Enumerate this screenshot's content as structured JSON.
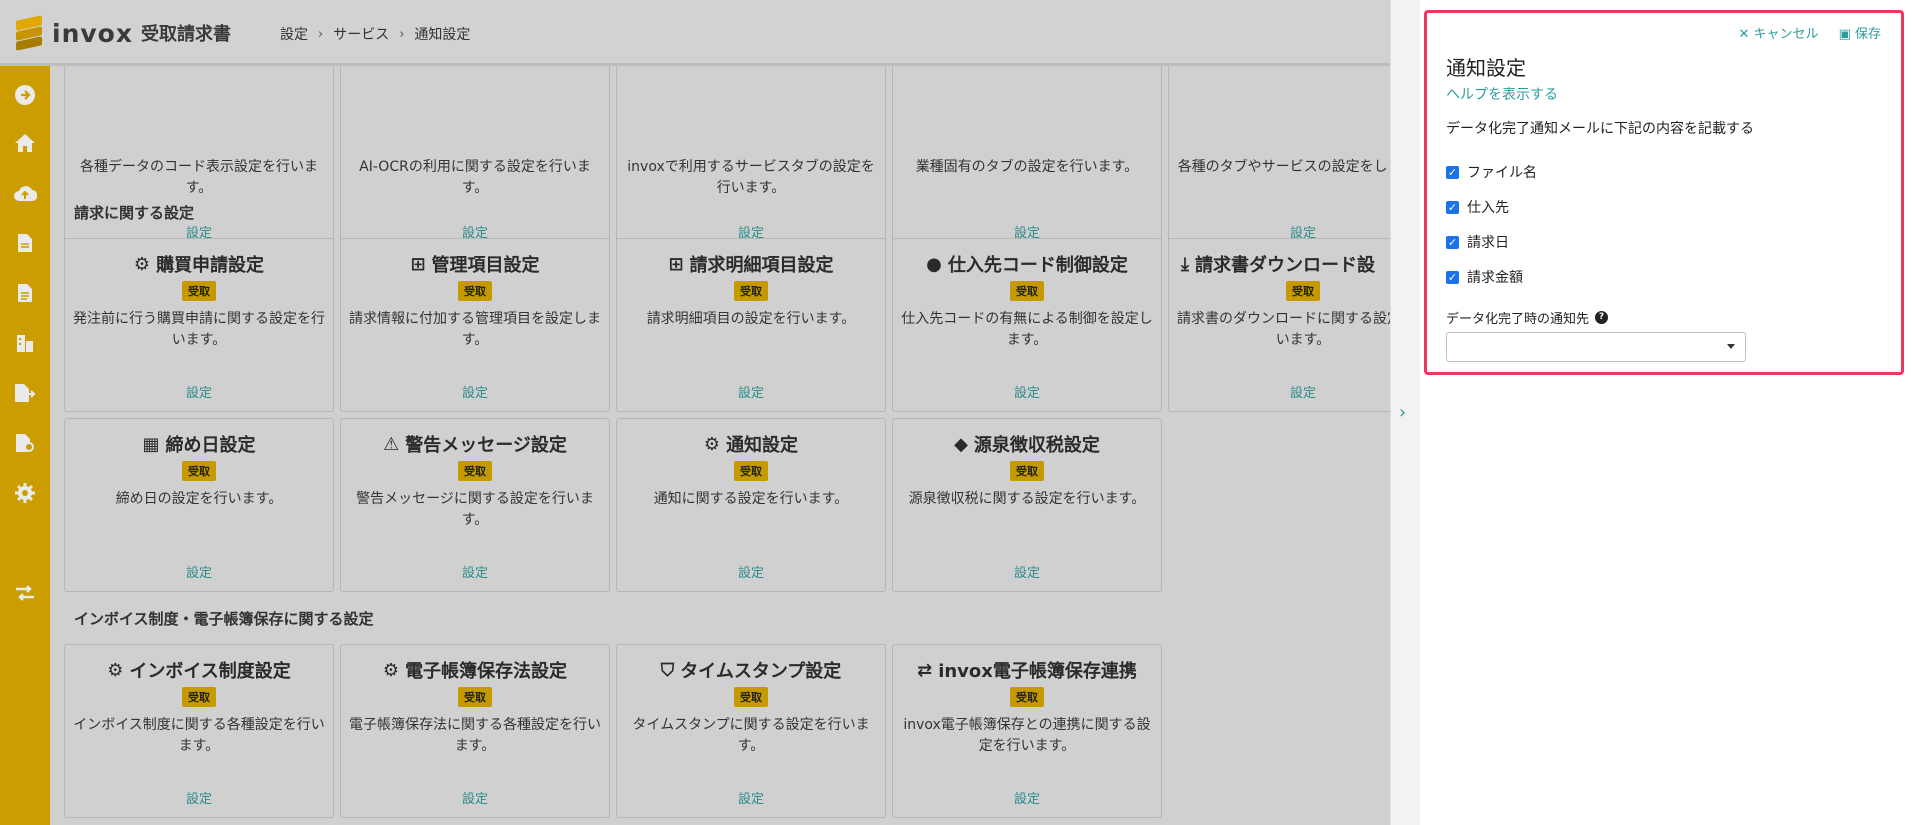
{
  "header": {
    "logo_text": "invox",
    "logo_sub": "受取請求書",
    "breadcrumb": [
      "設定",
      "サービス",
      "通知設定"
    ]
  },
  "sidebar": {
    "icons": [
      "arrow-right-circle-icon",
      "home-icon",
      "cloud-upload-icon",
      "document-icon",
      "document-icon",
      "building-icon",
      "file-export-icon",
      "file-settings-icon",
      "gear-icon",
      "transfer-icon"
    ]
  },
  "top_row": {
    "descs": [
      "各種データのコード表示設定を行います。",
      "AI-OCRの利用に関する設定を行います。",
      "invoxで利用するサービスタブの設定を行います。",
      "業種固有のタブの設定を行います。",
      "各種のタブやサービスの設定をします。"
    ],
    "link": "設定"
  },
  "sections": {
    "billing": "請求に関する設定",
    "invoice": "インボイス制度・電子帳簿保存に関する設定"
  },
  "badge": "受取",
  "link_label": "設定",
  "cards_row1": [
    {
      "title": "購買申請設定",
      "icon": "gears-icon",
      "desc": "発注前に行う購買申請に関する設定を行います。"
    },
    {
      "title": "管理項目設定",
      "icon": "sitemap-icon",
      "desc": "請求情報に付加する管理項目を設定します。"
    },
    {
      "title": "請求明細項目設定",
      "icon": "sitemap-icon",
      "desc": "請求明細項目の設定を行います。"
    },
    {
      "title": "仕入先コード制御設定",
      "icon": "abc-icon",
      "desc": "仕入先コードの有無による制御を設定します。"
    },
    {
      "title": "請求書ダウンロード設",
      "icon": "download-icon",
      "desc": "請求書のダウンロードに関する設定を行います。"
    }
  ],
  "cards_row2": [
    {
      "title": "締め日設定",
      "icon": "calendar-icon",
      "desc": "締め日の設定を行います。"
    },
    {
      "title": "警告メッセージ設定",
      "icon": "warning-icon",
      "desc": "警告メッセージに関する設定を行います。"
    },
    {
      "title": "通知設定",
      "icon": "gears-icon",
      "desc": "通知に関する設定を行います。"
    },
    {
      "title": "源泉徴収税設定",
      "icon": "tag-icon",
      "desc": "源泉徴収税に関する設定を行います。"
    }
  ],
  "cards_row3": [
    {
      "title": "インボイス制度設定",
      "icon": "gears-icon",
      "desc": "インボイス制度に関する各種設定を行います。"
    },
    {
      "title": "電子帳簿保存法設定",
      "icon": "gears-icon",
      "desc": "電子帳簿保存法に関する各種設定を行います。"
    },
    {
      "title": "タイムスタンプ設定",
      "icon": "shield-clock-icon",
      "desc": "タイムスタンプに関する設定を行います。"
    },
    {
      "title": "invox電子帳簿保存連携",
      "icon": "transfer-icon",
      "desc": "invox電子帳簿保存との連携に関する設定を行います。"
    }
  ],
  "panel": {
    "cancel": "キャンセル",
    "save": "保存",
    "title": "通知設定",
    "help": "ヘルプを表示する",
    "desc": "データ化完了通知メールに下記の内容を記載する",
    "checkboxes": [
      {
        "label": "ファイル名",
        "checked": true
      },
      {
        "label": "仕入先",
        "checked": true
      },
      {
        "label": "請求日",
        "checked": true
      },
      {
        "label": "請求金額",
        "checked": true
      }
    ],
    "notify_label": "データ化完了時の通知先",
    "select_value": ""
  },
  "colors": {
    "accent": "#cc9d00",
    "link": "#2a9d9d",
    "highlight": "#e8385f"
  }
}
